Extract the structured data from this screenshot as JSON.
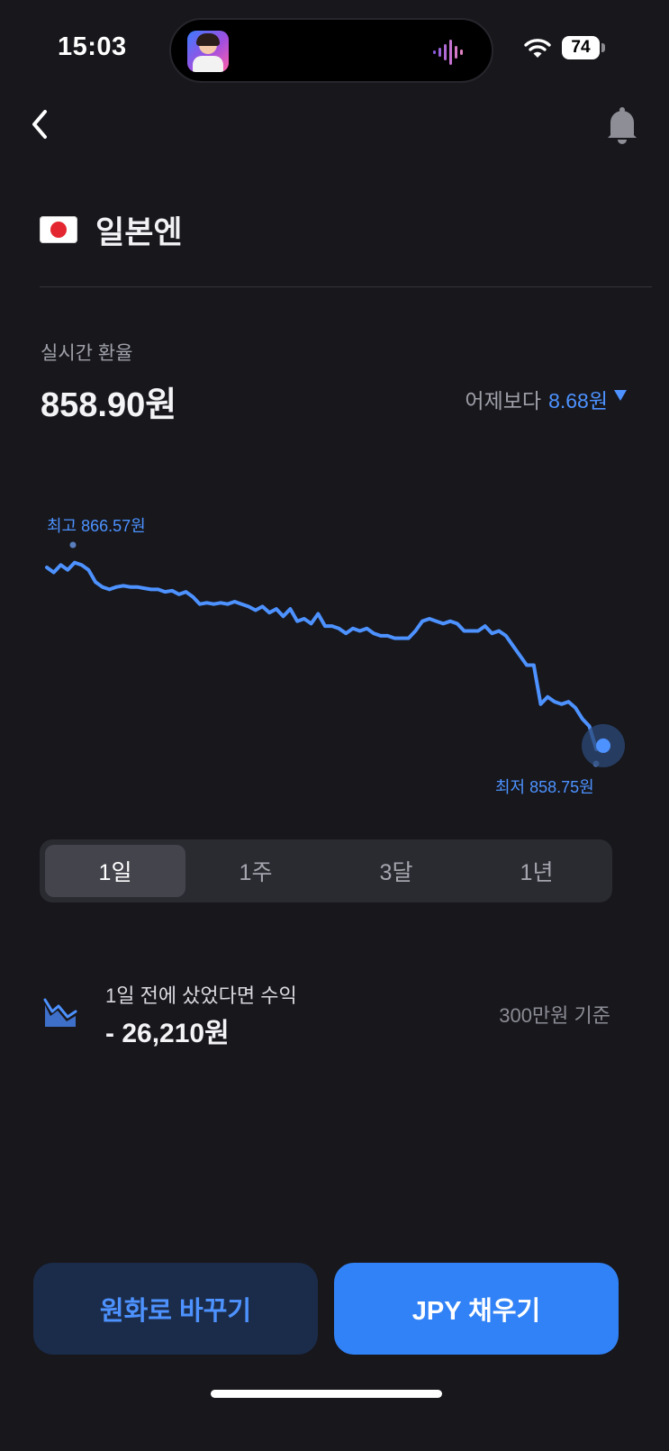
{
  "status_bar": {
    "time": "15:03",
    "battery": "74"
  },
  "header": {
    "currency_name": "일본엔",
    "flag_icon": "japan-flag-icon"
  },
  "rate": {
    "label": "실시간 환율",
    "value": "858.90원",
    "change_prefix": "어제보다",
    "change_amount": "8.68원",
    "change_direction": "down",
    "accent_color": "#4d92ff"
  },
  "chart_data": {
    "type": "line",
    "high_label": "최고 866.57원",
    "low_label": "최저 858.75원",
    "high": 866.57,
    "low": 858.75,
    "values": [
      866.2,
      866.0,
      866.3,
      866.1,
      866.4,
      866.3,
      866.1,
      865.6,
      865.4,
      865.3,
      865.4,
      865.45,
      865.4,
      865.4,
      865.35,
      865.3,
      865.3,
      865.2,
      865.25,
      865.1,
      865.2,
      865.0,
      864.7,
      864.75,
      864.7,
      864.75,
      864.7,
      864.8,
      864.7,
      864.6,
      864.45,
      864.6,
      864.35,
      864.5,
      864.2,
      864.5,
      864.0,
      864.1,
      863.9,
      864.3,
      863.8,
      863.8,
      863.7,
      863.5,
      863.7,
      863.6,
      863.7,
      863.5,
      863.4,
      863.4,
      863.3,
      863.3,
      863.3,
      863.6,
      864.0,
      864.1,
      864.0,
      863.9,
      864.0,
      863.9,
      863.6,
      863.6,
      863.6,
      863.8,
      863.5,
      863.6,
      863.4,
      863.0,
      862.6,
      862.2,
      862.2,
      860.6,
      860.9,
      860.7,
      860.6,
      860.7,
      860.45,
      860.0,
      859.7,
      858.75,
      858.9
    ]
  },
  "periods": [
    {
      "label": "1일",
      "active": true
    },
    {
      "label": "1주",
      "active": false
    },
    {
      "label": "3달",
      "active": false
    },
    {
      "label": "1년",
      "active": false
    }
  ],
  "profit": {
    "label": "1일 전에 샀었다면 수익",
    "value": "- 26,210원",
    "basis": "300만원 기준"
  },
  "actions": {
    "convert_label": "원화로 바꾸기",
    "fill_label": "JPY 채우기"
  }
}
